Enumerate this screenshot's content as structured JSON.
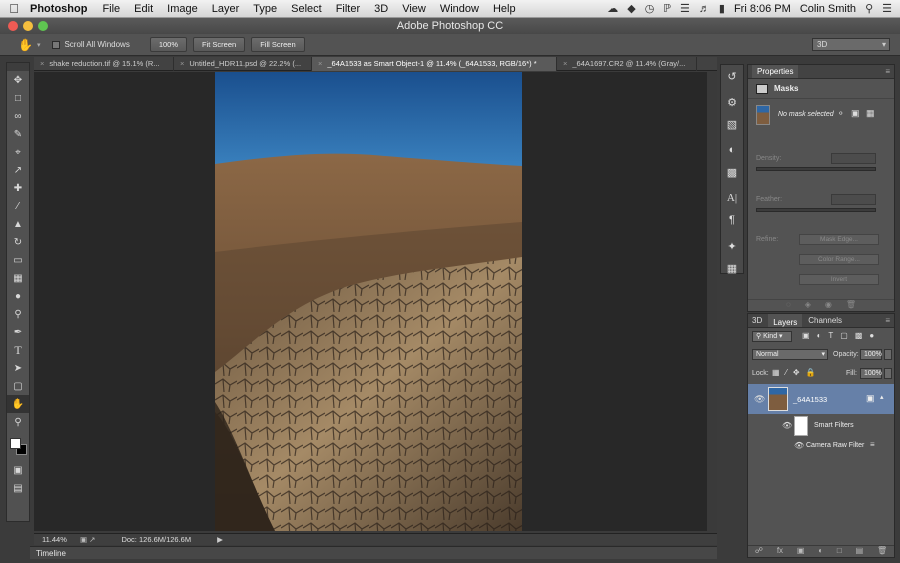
{
  "menubar": {
    "app_name": "Photoshop",
    "items": [
      "File",
      "Edit",
      "Image",
      "Layer",
      "Type",
      "Select",
      "Filter",
      "3D",
      "View",
      "Window",
      "Help"
    ],
    "clock": "Fri 8:06 PM",
    "user": "Colin Smith"
  },
  "window": {
    "title": "Adobe Photoshop CC"
  },
  "options_bar": {
    "scroll_all_label": "Scroll All Windows",
    "zoom_100": "100%",
    "fit_screen": "Fit Screen",
    "fill_screen": "Fill Screen",
    "workspace": "3D"
  },
  "tabs": [
    {
      "label": "shake reduction.tif @ 15.1% (R..."
    },
    {
      "label": "Untitled_HDR11.psd @ 22.2% (..."
    },
    {
      "label": "_64A1533 as Smart Object-1 @ 11.4% (_64A1533, RGB/16*) *"
    },
    {
      "label": "_64A1697.CR2 @ 11.4% (Gray/..."
    }
  ],
  "status": {
    "zoom": "11.44%",
    "doc": "Doc: 126.6M/126.6M"
  },
  "timeline": {
    "label": "Timeline"
  },
  "properties": {
    "tab": "Properties",
    "section": "Masks",
    "no_mask": "No mask selected",
    "density": "Density:",
    "feather": "Feather:",
    "refine": "Refine:",
    "mask_edge": "Mask Edge...",
    "color_range": "Color Range...",
    "invert": "Invert"
  },
  "layers": {
    "tab_3d": "3D",
    "tab_layers": "Layers",
    "tab_channels": "Channels",
    "kind": "Kind",
    "blend": "Normal",
    "opacity_label": "Opacity:",
    "opacity": "100%",
    "lock_label": "Lock:",
    "fill_label": "Fill:",
    "fill": "100%",
    "layer_name": "_64A1533",
    "smart_filters": "Smart Filters",
    "camera_raw": "Camera Raw Filter"
  },
  "colors": {
    "selected_layer": "#6680a8",
    "panel": "#535353",
    "canvas_bg": "#282828"
  }
}
